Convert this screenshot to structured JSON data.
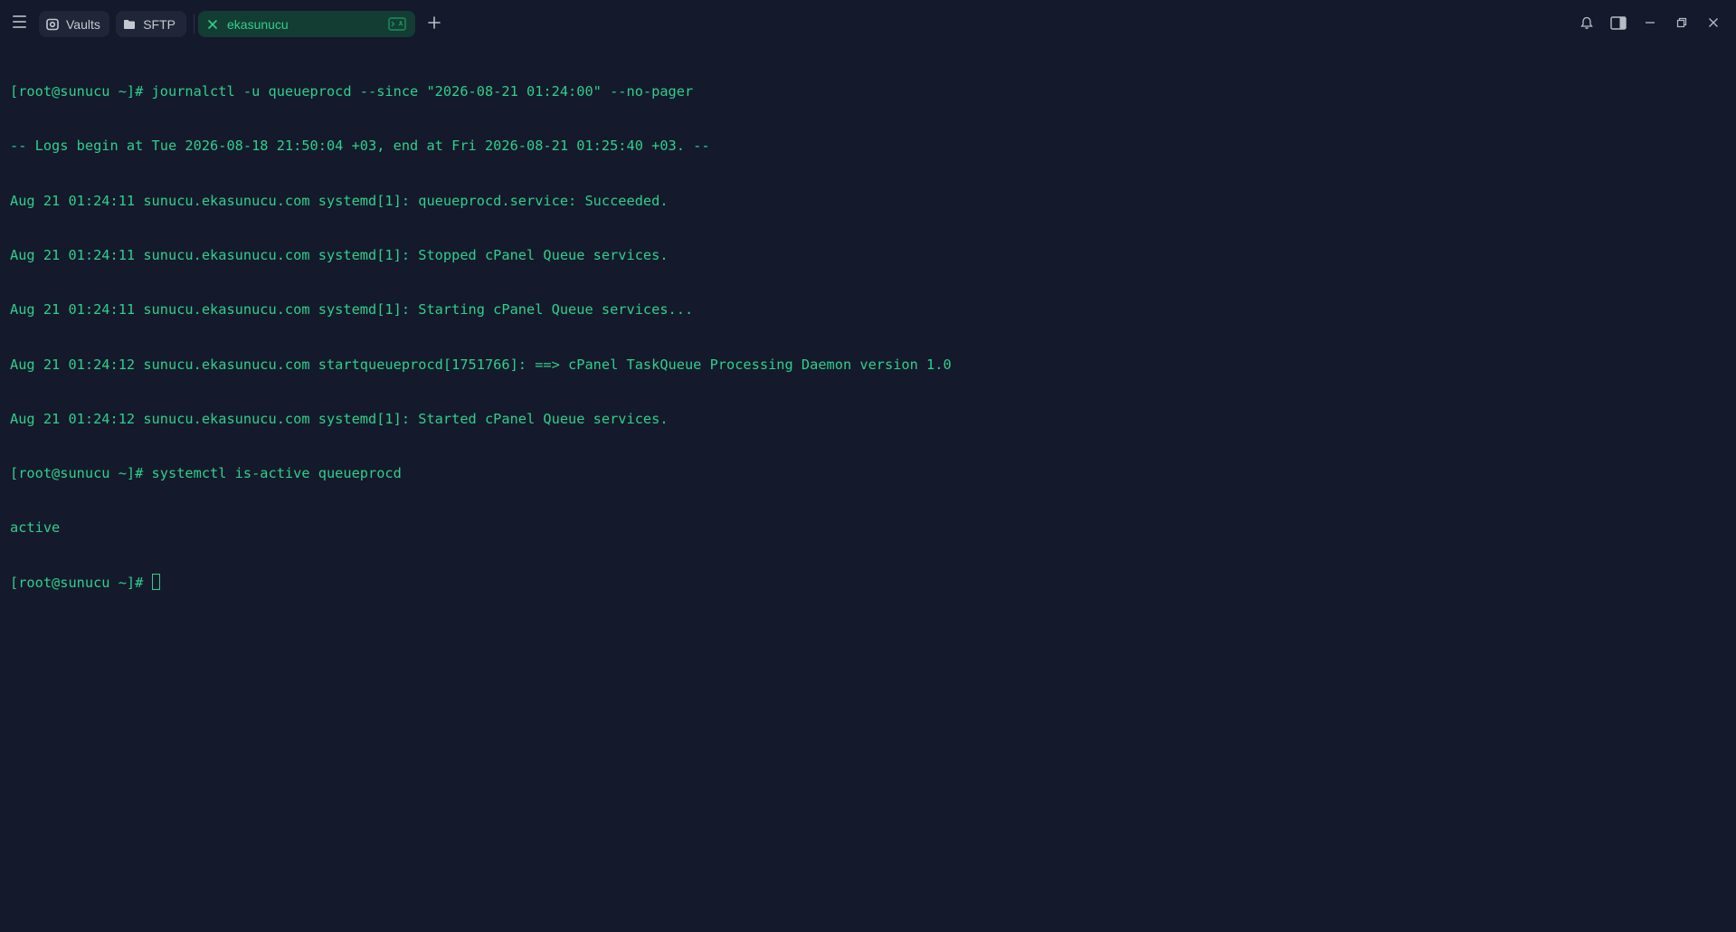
{
  "tabs": [
    {
      "label": "Vaults",
      "icon": "vault-icon"
    },
    {
      "label": "SFTP",
      "icon": "folder-icon"
    },
    {
      "label": "ekasunucu",
      "icon": "close-icon",
      "active": true,
      "status_icon": "terminal-icon"
    }
  ],
  "window_controls": [
    "bell-icon",
    "sidebar-toggle-icon",
    "minimize-icon",
    "restore-icon",
    "close-icon"
  ],
  "colors": {
    "background": "#141a2b",
    "terminal_text": "#2fcf8b",
    "active_tab_bg": "#133d33",
    "tab_bg": "#1f2637"
  },
  "terminal": {
    "lines": [
      "[root@sunucu ~]# journalctl -u queueprocd --since \"2026-08-21 01:24:00\" --no-pager",
      "-- Logs begin at Tue 2026-08-18 21:50:04 +03, end at Fri 2026-08-21 01:25:40 +03. --",
      "Aug 21 01:24:11 sunucu.ekasunucu.com systemd[1]: queueprocd.service: Succeeded.",
      "Aug 21 01:24:11 sunucu.ekasunucu.com systemd[1]: Stopped cPanel Queue services.",
      "Aug 21 01:24:11 sunucu.ekasunucu.com systemd[1]: Starting cPanel Queue services...",
      "Aug 21 01:24:12 sunucu.ekasunucu.com startqueueprocd[1751766]: ==> cPanel TaskQueue Processing Daemon version 1.0",
      "Aug 21 01:24:12 sunucu.ekasunucu.com systemd[1]: Started cPanel Queue services.",
      "[root@sunucu ~]# systemctl is-active queueprocd",
      "active"
    ],
    "prompt": "[root@sunucu ~]# "
  }
}
